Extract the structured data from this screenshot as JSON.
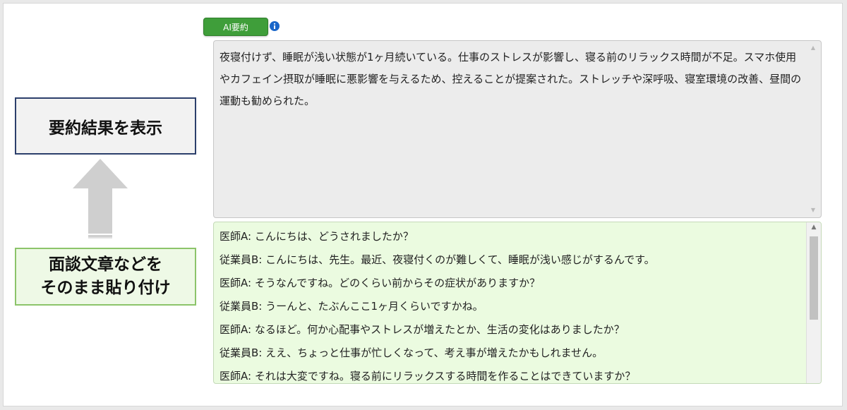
{
  "annotations": {
    "summary_label": "要約結果を表示",
    "paste_label_line1": "面談文章などを",
    "paste_label_line2": "そのまま貼り付け"
  },
  "ai_summary": {
    "button_label": "AI要約",
    "info_icon": "info-icon",
    "summary_text": "夜寝付けず、睡眠が浅い状態が1ヶ月続いている。仕事のストレスが影響し、寝る前のリラックス時間が不足。スマホ使用やカフェイン摂取が睡眠に悪影響を与えるため、控えることが提案された。ストレッチや深呼吸、寝室環境の改善、昼間の運動も勧められた。"
  },
  "conversation": {
    "lines": [
      "医師A: こんにちは、どうされましたか？",
      "従業員B: こんにちは、先生。最近、夜寝付くのが難しくて、睡眠が浅い感じがするんです。",
      "医師A: そうなんですね。どのくらい前からその症状がありますか？",
      "従業員B: うーんと、たぶんここ1ヶ月くらいですかね。",
      "医師A: なるほど。何か心配事やストレスが増えたとか、生活の変化はありましたか？",
      "従業員B: ええ、ちょっと仕事が忙しくなって、考え事が増えたかもしれません。",
      "医師A: それは大変ですね。寝る前にリラックスする時間を作ることはできていますか？"
    ]
  },
  "colors": {
    "accent_green": "#3f9e3a",
    "summary_border": "#2c3f6b",
    "paste_border": "#8cc46a",
    "conversation_bg": "#ebfbe0",
    "info_blue": "#1a66c9"
  }
}
